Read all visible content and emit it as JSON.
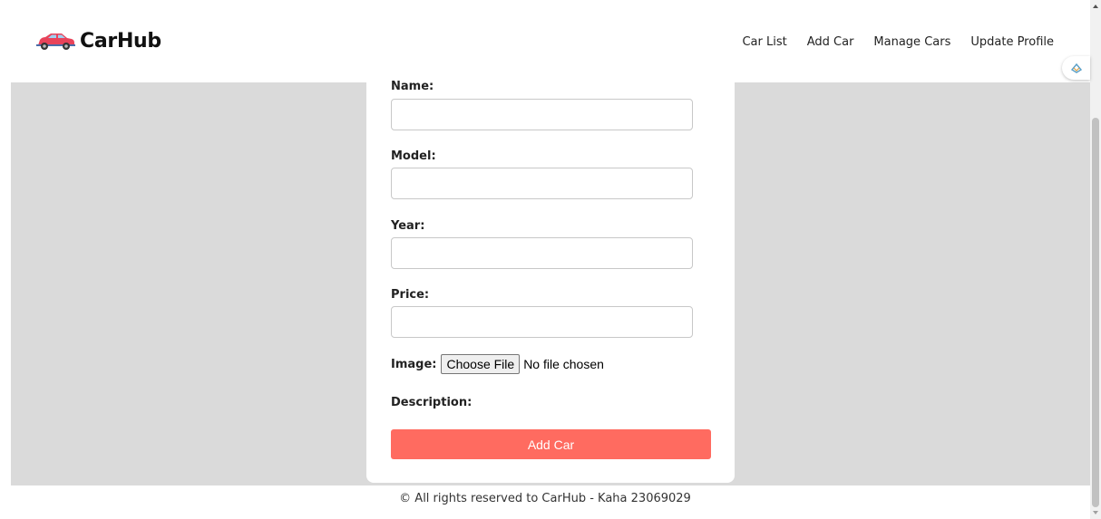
{
  "header": {
    "brand": "CarHub",
    "logo_icon": "car-icon",
    "nav": [
      "Car List",
      "Add Car",
      "Manage Cars",
      "Update Profile"
    ]
  },
  "side_badge": {
    "icon": "extension-icon"
  },
  "form": {
    "fields": [
      {
        "label": "Name:",
        "value": ""
      },
      {
        "label": "Model:",
        "value": ""
      },
      {
        "label": "Year:",
        "value": ""
      },
      {
        "label": "Price:",
        "value": ""
      }
    ],
    "image_label": "Image:",
    "file_button": "Choose File",
    "file_status": "No file chosen",
    "description_label": "Description:",
    "submit_label": "Add Car"
  },
  "footer": {
    "text": "© All rights reserved to CarHub - Kaha 23069029"
  },
  "colors": {
    "accent": "#ff6b60",
    "background_band": "#dadada",
    "card": "#ffffff"
  }
}
